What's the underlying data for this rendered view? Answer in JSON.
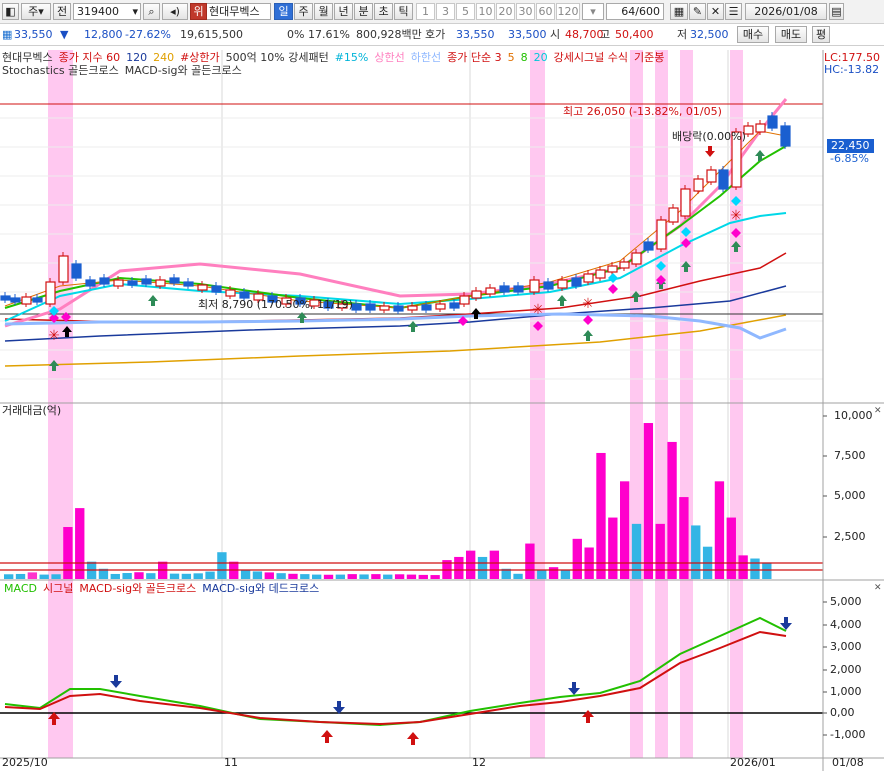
{
  "toolbar": {
    "period_label": "주",
    "prev_label": "전",
    "stock_code": "319400",
    "badge": "위",
    "stock_name": "현대무벡스",
    "timeframes": [
      "일",
      "주",
      "월",
      "년",
      "분",
      "초",
      "틱"
    ],
    "selected_timeframe": "일",
    "intervals": [
      "1",
      "3",
      "5",
      "10",
      "20",
      "30",
      "60",
      "120"
    ],
    "count": "64/600",
    "date": "2026/01/08",
    "sell_label": "매수",
    "buy_label": "매도",
    "avg_label": "평"
  },
  "quote": {
    "price": "33,550",
    "arrow": "▼",
    "change": "12,800",
    "change_pct": "-27.62%",
    "volume": "19,615,500",
    "ratio": "0% 17.61%",
    "amount": "800,928백만",
    "ask_label": "호가",
    "ask": "33,550",
    "bid": "33,500",
    "open_label": "시",
    "open": "48,700",
    "high_label": "고",
    "high": "50,400",
    "low_label": "저",
    "low": "32,500"
  },
  "price_panel": {
    "legend_row1": [
      {
        "text": "현대무벡스",
        "color": "#333333"
      },
      {
        "text": "종가 지수 60",
        "color": "#d01010"
      },
      {
        "text": "120",
        "color": "#1a3a9c"
      },
      {
        "text": "240",
        "color": "#e0a000"
      },
      {
        "text": "#상한가",
        "color": "#d01010"
      },
      {
        "text": "500억 10% 강세패턴",
        "color": "#333333"
      },
      {
        "text": "#15%",
        "color": "#00b4d8"
      },
      {
        "text": "상한선",
        "color": "#ff7fbf"
      },
      {
        "text": "하한선",
        "color": "#8fb8ff"
      },
      {
        "text": "종가 단순 3",
        "color": "#d01010"
      },
      {
        "text": "5",
        "color": "#e07000"
      },
      {
        "text": "8",
        "color": "#22c000"
      },
      {
        "text": "20",
        "color": "#00c8d8"
      },
      {
        "text": "강세시그널 수식",
        "color": "#d01010"
      },
      {
        "text": "기준봉",
        "color": "#d01010"
      }
    ],
    "legend_row2": [
      {
        "text": "Stochastics 골든크로스",
        "color": "#333333"
      },
      {
        "text": "MACD-sig와 골든크로스",
        "color": "#333333"
      }
    ],
    "lc": "LC:177.50",
    "hc": "HC:-13.82",
    "max_note": "최고 26,050 (-13.82%, 01/05)",
    "min_note": "최저 8,790 (170.50%, 11/19)",
    "dividend_note": "배당락(0.00%)",
    "current_price": "22,450",
    "current_pct": "-6.85%"
  },
  "volume_panel": {
    "title": "거래대금(억)",
    "axis_ticks": [
      "10,000",
      "7,500",
      "5,000",
      "2,500"
    ],
    "values": [
      300,
      320,
      420,
      280,
      300,
      3300,
      4500,
      1100,
      650,
      320,
      380,
      430,
      370,
      1100,
      340,
      330,
      360,
      470,
      1700,
      1100,
      580,
      480,
      420,
      370,
      330,
      310,
      280,
      270,
      280,
      310,
      290,
      310,
      280,
      300,
      280,
      260,
      250,
      1200,
      1400,
      1800,
      1400,
      1800,
      650,
      330,
      2250,
      560,
      750,
      600,
      2550,
      2000,
      8000,
      3900,
      6200,
      3500,
      9900,
      3500,
      8700,
      5200,
      3400,
      2050,
      6200,
      3900,
      1500,
      1300,
      1050
    ],
    "colors": [
      "#33b5e5",
      "#33b5e5",
      "#ff33cc",
      "#33b5e5",
      "#33b5e5",
      "#ff00cc",
      "#ff00cc",
      "#33b5e5",
      "#33b5e5",
      "#33b5e5",
      "#33b5e5",
      "#ff00cc",
      "#33b5e5",
      "#ff00cc",
      "#33b5e5",
      "#33b5e5",
      "#33b5e5",
      "#33b5e5",
      "#33b5e5",
      "#ff00cc",
      "#33b5e5",
      "#33b5e5",
      "#ff00cc",
      "#33b5e5",
      "#ff00cc",
      "#33b5e5",
      "#33b5e5",
      "#ff00cc",
      "#33b5e5",
      "#ff00cc",
      "#33b5e5",
      "#ff00cc",
      "#33b5e5",
      "#ff00cc",
      "#ff00cc",
      "#ff00cc",
      "#ff00cc",
      "#ff00cc",
      "#ff00cc",
      "#ff00cc",
      "#33b5e5",
      "#ff00cc",
      "#33b5e5",
      "#33b5e5",
      "#ff00cc",
      "#33b5e5",
      "#ff00cc",
      "#33b5e5",
      "#ff00cc",
      "#ff00cc",
      "#ff00cc",
      "#ff00cc",
      "#ff00cc",
      "#33b5e5",
      "#ff00cc",
      "#ff00cc",
      "#ff00cc",
      "#ff00cc",
      "#33b5e5",
      "#33b5e5",
      "#ff00cc",
      "#ff00cc",
      "#ff00cc",
      "#33b5e5",
      "#33b5e5"
    ]
  },
  "macd_panel": {
    "legend": [
      {
        "text": "MACD",
        "color": "#22c000"
      },
      {
        "text": "시그널",
        "color": "#d01010"
      },
      {
        "text": "MACD-sig와 골든크로스",
        "color": "#d01010"
      },
      {
        "text": "MACD-sig와 데드크로스",
        "color": "#1a3a9c"
      }
    ],
    "axis_ticks": [
      "5,000",
      "4,000",
      "3,000",
      "2,000",
      "1,000",
      "0,00",
      "-1,000"
    ]
  },
  "x_axis": {
    "labels": [
      "2025/10",
      "11",
      "12",
      "2026/01",
      "01/08"
    ]
  },
  "colors": {
    "up": "#d01010",
    "down": "#1a5fd0",
    "highlight": "#ffc8f0",
    "panel_border": "#a0a0a0"
  }
}
